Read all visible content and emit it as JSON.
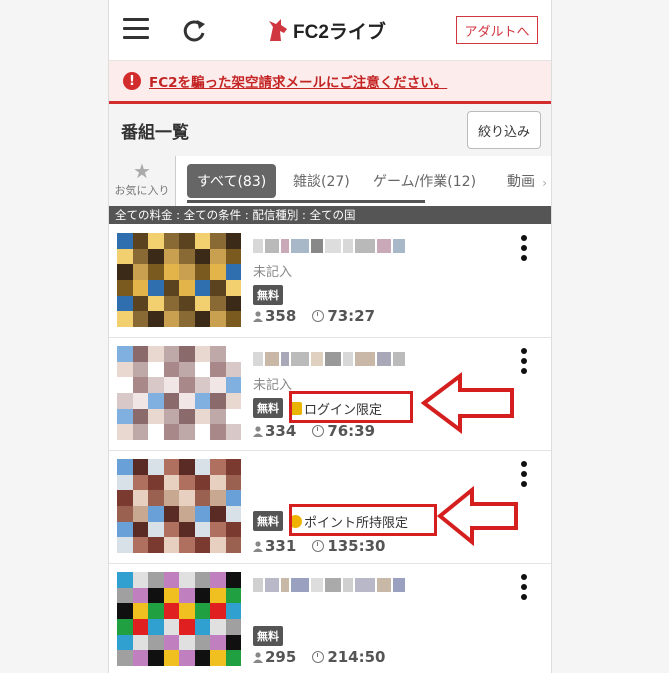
{
  "header": {
    "logo_text": "FC2ライブ",
    "adult_button": "アダルトへ"
  },
  "notice": {
    "text": "FC2を騙った架空請求メールにご注意ください。"
  },
  "list": {
    "title": "番組一覧",
    "filter_button": "絞り込み"
  },
  "tabs": {
    "favorite": "お気に入り",
    "items": [
      {
        "label": "すべて(83)",
        "active": true
      },
      {
        "label": "雑談(27)",
        "active": false
      },
      {
        "label": "ゲーム/作業(12)",
        "active": false
      },
      {
        "label": "動画",
        "active": false
      }
    ]
  },
  "conditions": "全ての料金 : 全ての条件 : 配信種別 : 全ての国",
  "programs": [
    {
      "subtitle": "未記入",
      "price": "無料",
      "restriction": "",
      "viewers": "358",
      "duration": "73:27"
    },
    {
      "subtitle": "未記入",
      "price": "無料",
      "restriction": "ログイン限定",
      "viewers": "334",
      "duration": "76:39"
    },
    {
      "subtitle": "",
      "price": "無料",
      "restriction": "ポイント所持限定",
      "viewers": "331",
      "duration": "135:30"
    },
    {
      "subtitle": "",
      "price": "無料",
      "restriction": "",
      "viewers": "295",
      "duration": "214:50"
    }
  ],
  "colors": {
    "accent_red": "#d22c2c",
    "notice_bg": "#fdecec",
    "badge_gray": "#555555"
  }
}
